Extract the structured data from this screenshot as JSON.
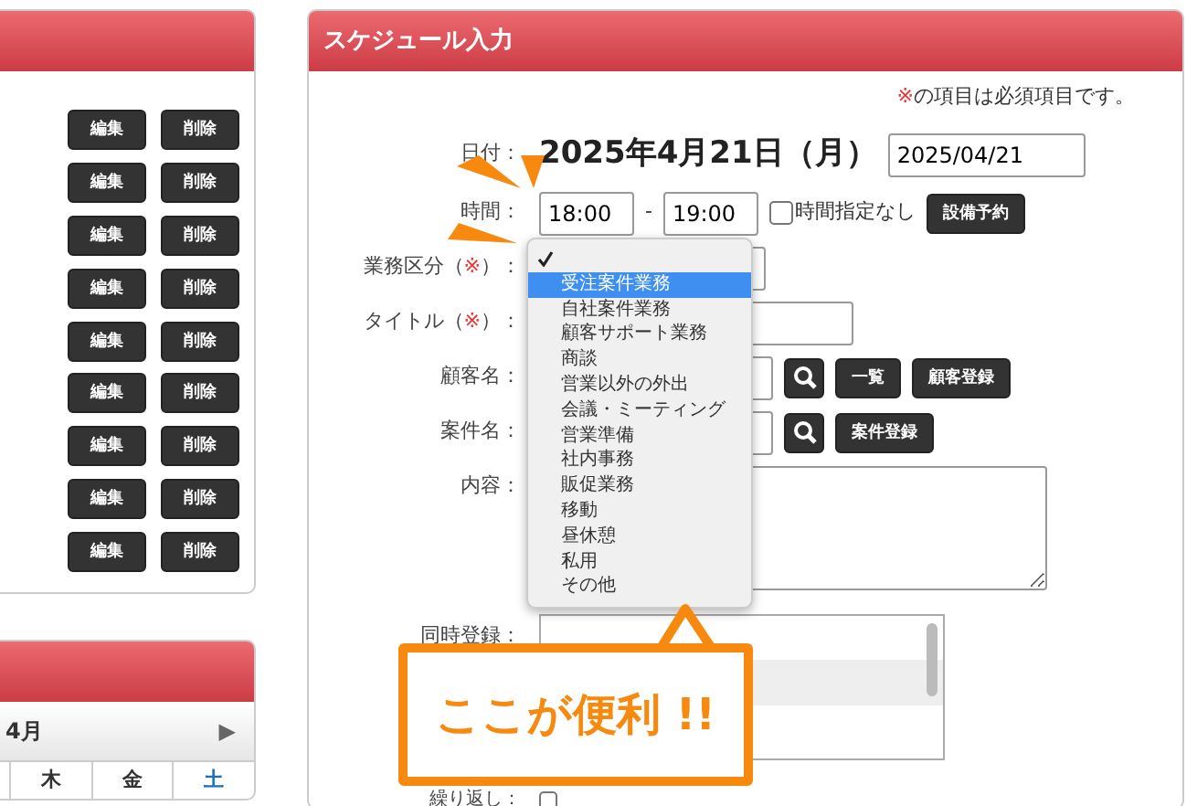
{
  "list_panel": {
    "rows": [
      {
        "edit": "編集",
        "delete": "削除"
      },
      {
        "edit": "編集",
        "delete": "削除"
      },
      {
        "edit": "編集",
        "delete": "削除"
      },
      {
        "edit": "編集",
        "delete": "削除"
      },
      {
        "edit": "編集",
        "delete": "削除"
      },
      {
        "edit": "編集",
        "delete": "削除"
      },
      {
        "edit": "編集",
        "delete": "削除"
      },
      {
        "edit": "編集",
        "delete": "削除"
      },
      {
        "edit": "編集",
        "delete": "削除"
      }
    ]
  },
  "calendar": {
    "month": "4月",
    "next": "▶",
    "weekdays": [
      {
        "label": "木",
        "kind": "weekday"
      },
      {
        "label": "金",
        "kind": "weekday"
      },
      {
        "label": "土",
        "kind": "saturday"
      }
    ]
  },
  "schedule_form": {
    "title": "スケジュール入力",
    "required_mark": "※",
    "required_note": "の項目は必須項目です。",
    "date": {
      "label": "日付：",
      "display": "2025年4月21日（月）",
      "value": "2025/04/21"
    },
    "time": {
      "label": "時間：",
      "start": "18:00",
      "separator": "-",
      "end": "19:00",
      "no_time": {
        "label": "時間指定なし",
        "checked": false
      },
      "button": "設備予約"
    },
    "category": {
      "label_before": "業務区分（",
      "mark": "※",
      "label_after": "）："
    },
    "title_field": {
      "label_before": "タイトル（",
      "mark": "※",
      "label_after": "）："
    },
    "customer": {
      "label": "顧客名：",
      "buttons": [
        "一覧",
        "顧客登録"
      ]
    },
    "project": {
      "label": "案件名：",
      "buttons": [
        "案件登録"
      ]
    },
    "content": {
      "label": "内容："
    },
    "simultaneous": {
      "label": "同時登録："
    },
    "repeat": {
      "label": "繰り返し：",
      "checked": false
    }
  },
  "dropdown": {
    "options": [
      {
        "checked": true,
        "highlighted": false
      },
      {
        "label": "受注案件業務",
        "checked": false,
        "highlighted": true
      },
      {
        "label": "自社案件業務",
        "checked": false,
        "highlighted": false
      },
      {
        "label": "顧客サポート業務",
        "checked": false,
        "highlighted": false
      },
      {
        "label": "商談",
        "checked": false,
        "highlighted": false
      },
      {
        "label": "営業以外の外出",
        "checked": false,
        "highlighted": false
      },
      {
        "label": "会議・ミーティング",
        "checked": false,
        "highlighted": false
      },
      {
        "label": "営業準備",
        "checked": false,
        "highlighted": false
      },
      {
        "label": "社内事務",
        "checked": false,
        "highlighted": false
      },
      {
        "label": "販促業務",
        "checked": false,
        "highlighted": false
      },
      {
        "label": "移動",
        "checked": false,
        "highlighted": false
      },
      {
        "label": "昼休憩",
        "checked": false,
        "highlighted": false
      },
      {
        "label": "私用",
        "checked": false,
        "highlighted": false
      },
      {
        "label": "その他",
        "checked": false,
        "highlighted": false
      }
    ]
  },
  "callout": {
    "text": "ここが便利 !!"
  }
}
